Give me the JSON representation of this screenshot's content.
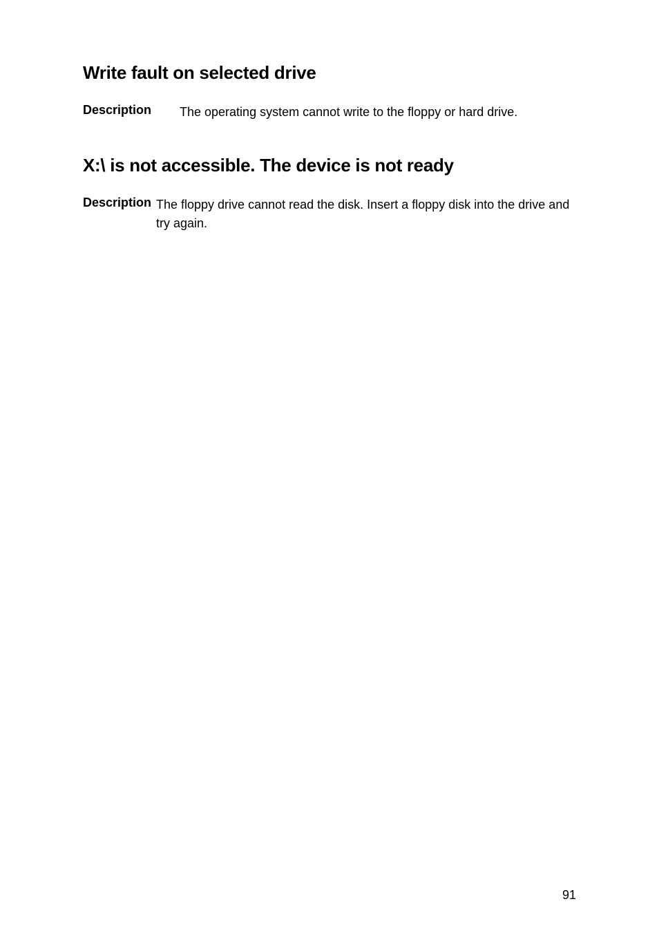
{
  "sections": [
    {
      "heading": "Write fault on selected drive",
      "label": "Description",
      "value": "The operating system cannot write to the floppy or hard drive."
    },
    {
      "heading": "X:\\ is not accessible. The device is not ready",
      "label": "Description",
      "value": "The floppy drive cannot read the disk. Insert a floppy disk into the drive and try again."
    }
  ],
  "pageNumber": "91"
}
